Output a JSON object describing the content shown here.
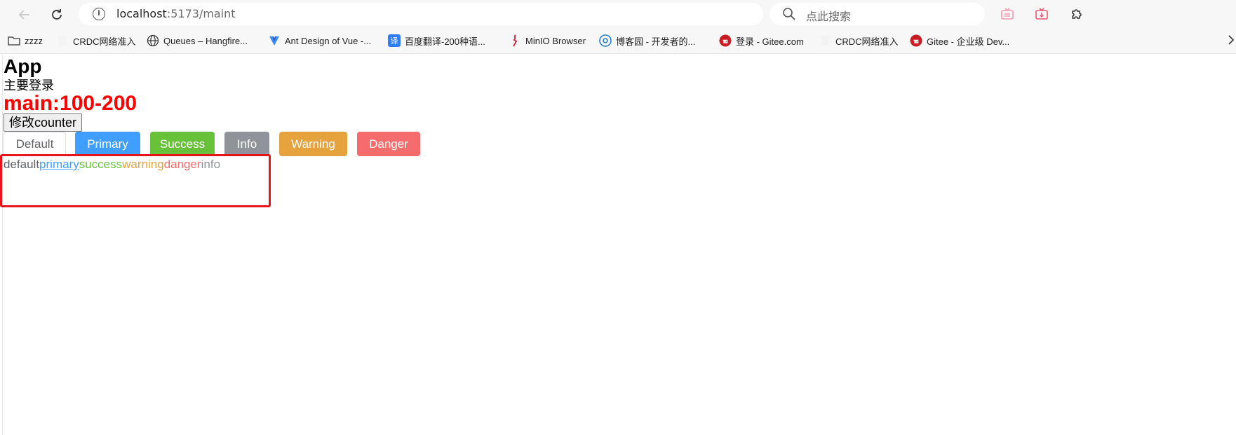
{
  "browser": {
    "url_host": "localhost",
    "url_rest": ":5173/maint",
    "search_placeholder": "点此搜索"
  },
  "bookmarks": [
    {
      "label": "zzzz",
      "icon": "folder-icon"
    },
    {
      "label": "CRDC网络准入",
      "icon": "blank-page-icon"
    },
    {
      "label": "Queues – Hangfire...",
      "icon": "globe-icon"
    },
    {
      "label": "Ant Design of Vue -...",
      "icon": "antdv-logo-icon"
    },
    {
      "label": "百度翻译-200种语...",
      "icon": "baidu-translate-icon"
    },
    {
      "label": "MinIO Browser",
      "icon": "minio-bird-icon"
    },
    {
      "label": "博客园 - 开发者的...",
      "icon": "cnblogs-icon"
    },
    {
      "label": "登录 - Gitee.com",
      "icon": "gitee-icon"
    },
    {
      "label": "CRDC网络准入",
      "icon": "blank-page-icon"
    },
    {
      "label": "Gitee - 企业级 Dev...",
      "icon": "gitee-icon"
    }
  ],
  "app": {
    "title": "App",
    "subtitle": "主要登录",
    "main_text": "main:100-200",
    "counter_button": "修改counter"
  },
  "buttons": [
    {
      "label": "Default",
      "type": "default",
      "color": "#ffffff"
    },
    {
      "label": "Primary",
      "type": "primary",
      "color": "#409eff"
    },
    {
      "label": "Success",
      "type": "success",
      "color": "#67c23a"
    },
    {
      "label": "Info",
      "type": "info",
      "color": "#909399"
    },
    {
      "label": "Warning",
      "type": "warning",
      "color": "#e6a23c"
    },
    {
      "label": "Danger",
      "type": "danger",
      "color": "#f56c6c"
    }
  ],
  "links": [
    {
      "label": "default",
      "color": "#606266"
    },
    {
      "label": "primary",
      "color": "#409eff"
    },
    {
      "label": "success",
      "color": "#67c23a"
    },
    {
      "label": "warning",
      "color": "#e6a23c"
    },
    {
      "label": "danger",
      "color": "#f56c6c"
    },
    {
      "label": "info",
      "color": "#909399"
    }
  ],
  "annotation": {
    "color": "#e8141b"
  }
}
